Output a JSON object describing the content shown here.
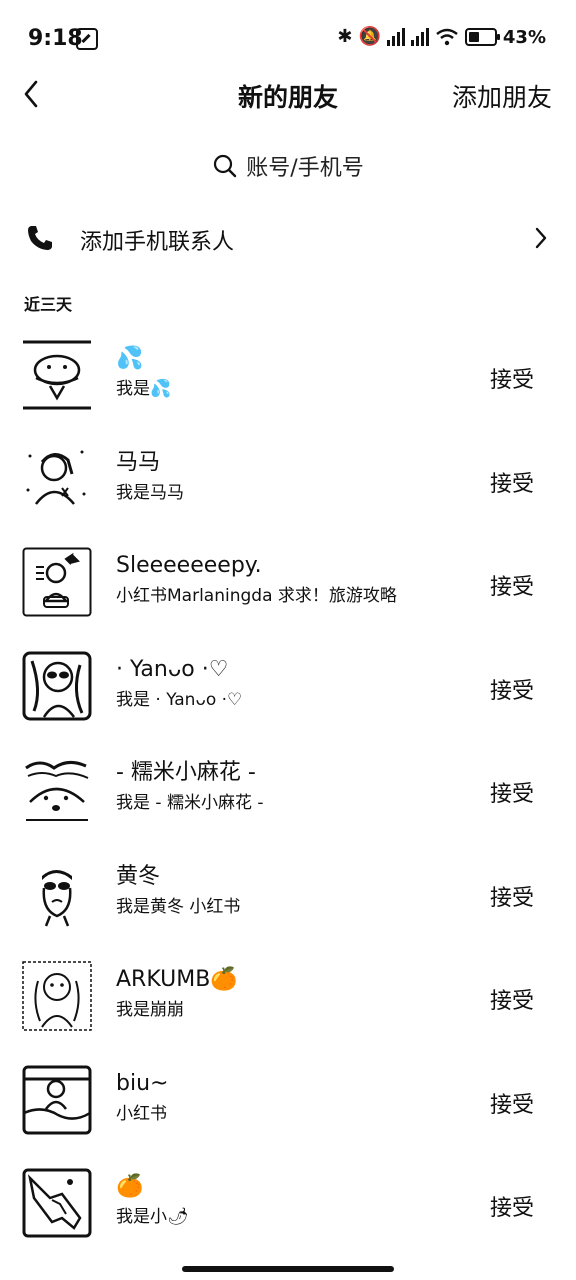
{
  "status_bar": {
    "time": "9:18",
    "battery": "43%",
    "icons": [
      "bluetooth-icon",
      "mute-icon",
      "signal-icon",
      "signal-icon",
      "wifi-icon",
      "battery-icon"
    ]
  },
  "nav": {
    "title": "新的朋友",
    "action": "添加朋友"
  },
  "search": {
    "placeholder": "账号/手机号"
  },
  "add_contacts": {
    "label": "添加手机联系人"
  },
  "section": {
    "label": "近三天"
  },
  "requests": [
    {
      "name": "💦",
      "message": "我是💦",
      "action": "接受"
    },
    {
      "name": "马马",
      "message": "我是马马",
      "action": "接受"
    },
    {
      "name": "Sleeeeeeepy.",
      "message": "小红书Marlaningda 求求！旅游攻略",
      "action": "接受"
    },
    {
      "name": "· Yanᴗo ·♡",
      "message": "我是 · Yanᴗo ·♡",
      "action": "接受"
    },
    {
      "name": "- 糯米小麻花 -",
      "message": "我是 - 糯米小麻花 -",
      "action": "接受"
    },
    {
      "name": "黄冬",
      "message": "我是黄冬 小红书",
      "action": "接受"
    },
    {
      "name": "ARKUMB🍊",
      "message": "我是崩崩",
      "action": "接受"
    },
    {
      "name": "biu~",
      "message": "小红书",
      "action": "接受"
    },
    {
      "name": "🍊",
      "message": "我是小🌶",
      "action": "接受"
    }
  ]
}
